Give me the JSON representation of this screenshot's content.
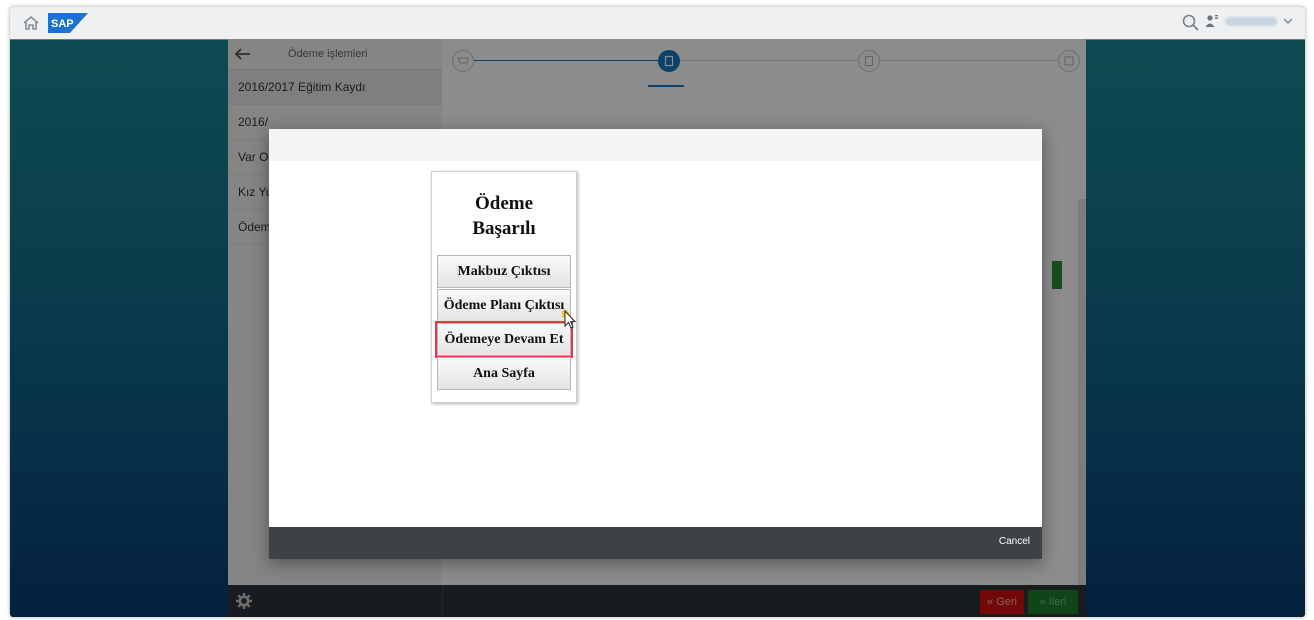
{
  "topbar": {
    "logo": "SAP"
  },
  "sidepanel": {
    "title": "Ödeme işlemleri",
    "items": [
      {
        "label": "2016/2017 Eğitim Kaydı"
      },
      {
        "label": "2016/"
      },
      {
        "label": "Var O"
      },
      {
        "label": "Kız Yu"
      },
      {
        "label": "Ödem"
      }
    ]
  },
  "dialog": {
    "card_title_line1": "Ödeme",
    "card_title_line2": "Başarılı",
    "buttons": {
      "receipt": "Makbuz Çıktısı",
      "plan": "Ödeme Planı Çıktısı",
      "continue": "Ödemeye Devam Et",
      "home": "Ana Sayfa"
    },
    "cancel": "Cancel"
  },
  "footer": {
    "back": "Geri",
    "next": "İleri"
  },
  "colors": {
    "accent": "#1178c1",
    "back_red": "#d00f0f",
    "next_green": "#1d7f2a",
    "highlight": "#e03b3b"
  }
}
